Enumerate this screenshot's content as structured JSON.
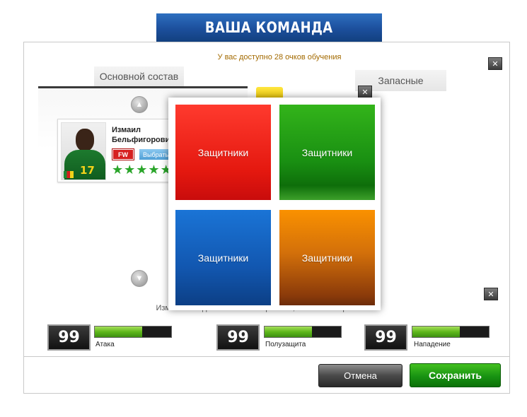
{
  "header": {
    "title": "ВАША КОМАНДА"
  },
  "info": {
    "points_text": "У вас доступно 28 очков обучения"
  },
  "tabs": {
    "main_squad": "Основной состав",
    "substitutes": "Запасные"
  },
  "icons": {
    "close": "close-icon",
    "arrow_up": "chevron-up-icon",
    "arrow_down": "chevron-down-icon",
    "star": "star-icon",
    "flag": "cameroon-flag-icon"
  },
  "player": {
    "first_name": "Измаил",
    "last_name": "Бельфигорови",
    "position": "FW",
    "select_label": "Выбрать",
    "jersey_number": "17",
    "stars": 5
  },
  "modal": {
    "tiles": [
      {
        "label": "Защитники",
        "color": "#e4180f"
      },
      {
        "label": "Защитники",
        "color": "#198f12"
      },
      {
        "label": "Защитники",
        "color": "#1257b0"
      },
      {
        "label": "Защитники",
        "color": "#d3700a"
      }
    ]
  },
  "notice": "Изменения сделаны но не сохранены, нажмите сохранить",
  "stats": [
    {
      "value": "99",
      "label": "Атака",
      "fill": 0.62
    },
    {
      "value": "99",
      "label": "Полузащита",
      "fill": 0.62
    },
    {
      "value": "99",
      "label": "Нападение",
      "fill": 0.62
    }
  ],
  "buttons": {
    "cancel": "Отмена",
    "save": "Сохранить"
  },
  "colors": {
    "header_blue": "#1c4f9c",
    "save_green": "#189212",
    "accent_orange": "#a36a00"
  }
}
